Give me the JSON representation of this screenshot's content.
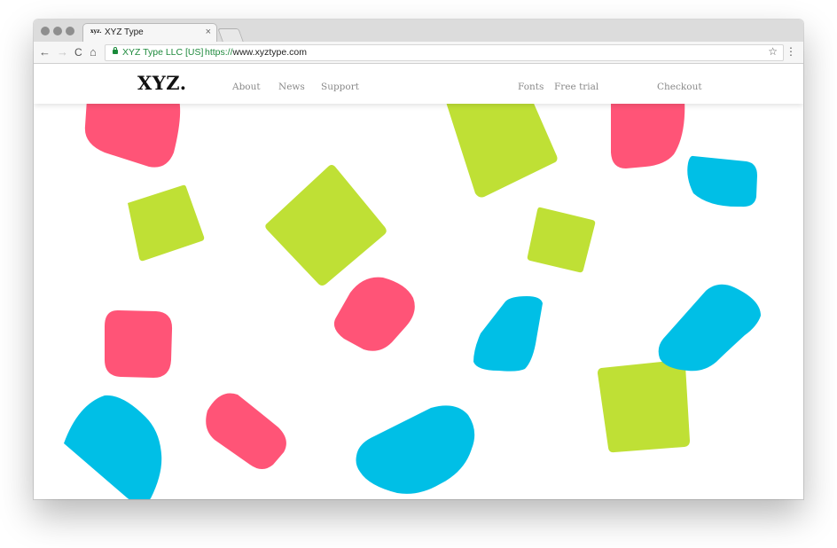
{
  "browser": {
    "tab": {
      "favicon_text": "xyz.",
      "title": "XYZ Type",
      "close": "×"
    },
    "nav": {
      "back": "←",
      "forward": "→",
      "reload": "C",
      "home": "⌂"
    },
    "omnibox": {
      "origin": "XYZ Type LLC [US]",
      "url_scheme": "https://",
      "url_host": "www.xyztype.com"
    },
    "star": "☆",
    "menu": "⋮"
  },
  "site": {
    "logo": "XYZ.",
    "nav_left": [
      "About",
      "News",
      "Support"
    ],
    "nav_right": [
      "Fonts",
      "Free trial"
    ],
    "checkout": "Checkout"
  },
  "colors": {
    "pink": "#ff5477",
    "green": "#bfe035",
    "blue": "#00bfe6"
  }
}
